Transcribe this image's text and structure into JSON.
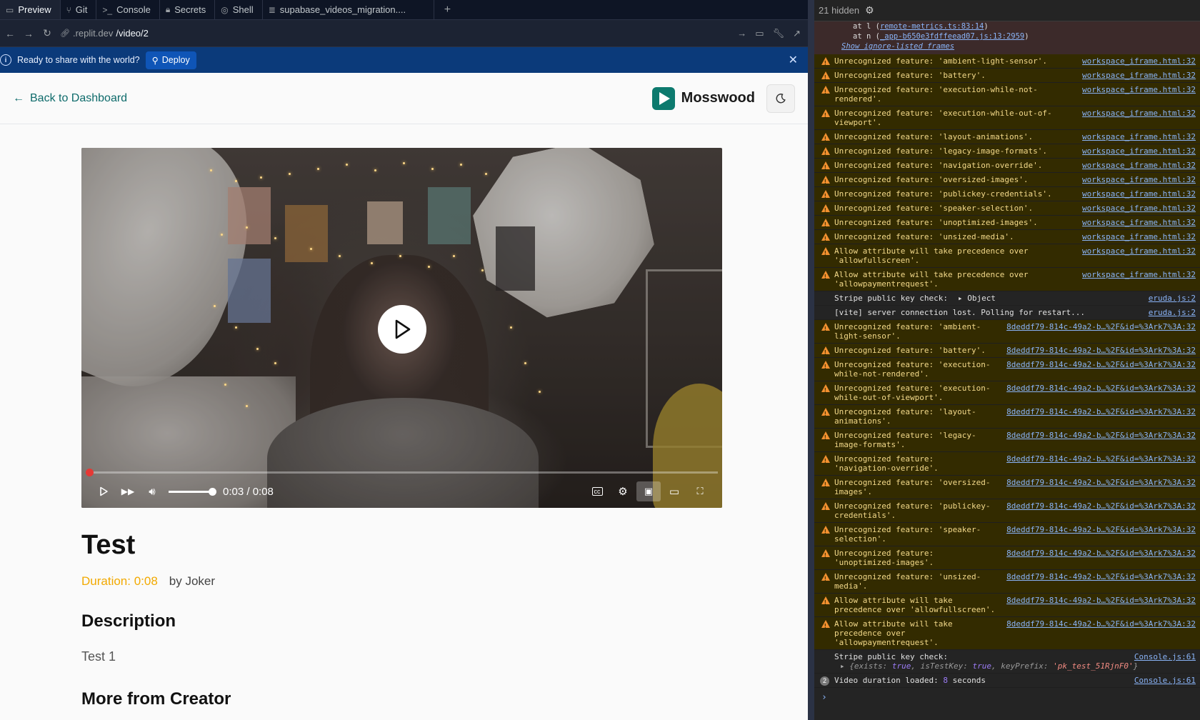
{
  "tabs": [
    {
      "label": "Preview",
      "icon": "monitor-icon",
      "active": true
    },
    {
      "label": "Git",
      "icon": "git-icon"
    },
    {
      "label": "Console",
      "icon": "terminal-icon"
    },
    {
      "label": "Secrets",
      "icon": "lock-icon"
    },
    {
      "label": "Shell",
      "icon": "shell-icon"
    },
    {
      "label": "supabase_videos_migration....",
      "icon": "database-icon"
    }
  ],
  "url": {
    "host": ".replit.dev",
    "path": "/video/2"
  },
  "deploy_bar": {
    "message": "Ready to share with the world?",
    "button": "Deploy"
  },
  "app": {
    "back_label": "Back to Dashboard",
    "brand": "Mosswood",
    "video": {
      "current_time": "0:03",
      "duration": "0:08",
      "time_display": "0:03 / 0:08",
      "progress_fraction": 0.006,
      "volume_fraction": 1.0
    },
    "title": "Test",
    "duration_label": "Duration: 0:08",
    "author_label": "by Joker",
    "description_heading": "Description",
    "description": "Test 1",
    "more_heading": "More from Creator"
  },
  "console": {
    "hidden_count": "21 hidden",
    "stack": {
      "line1_prefix": "at l (",
      "line1_link": "remote-metrics.ts:83:14",
      "line1_suffix": ")",
      "line2_prefix": "at n (",
      "line2_link": "_app-b650e3fdffeead07.js:13:2959",
      "line2_suffix": ")",
      "ignore_link": "Show ignore-listed frames"
    },
    "entries": [
      {
        "type": "warn",
        "text": "Unrecognized feature: 'ambient-light-sensor'.",
        "src": "workspace_iframe.html:32"
      },
      {
        "type": "warn",
        "text": "Unrecognized feature: 'battery'.",
        "src": "workspace_iframe.html:32"
      },
      {
        "type": "warn",
        "text": "Unrecognized feature: 'execution-while-not-\nrendered'.",
        "src": "workspace_iframe.html:32"
      },
      {
        "type": "warn",
        "text": "Unrecognized feature: 'execution-while-out-of-\nviewport'.",
        "src": "workspace_iframe.html:32"
      },
      {
        "type": "warn",
        "text": "Unrecognized feature: 'layout-animations'.",
        "src": "workspace_iframe.html:32"
      },
      {
        "type": "warn",
        "text": "Unrecognized feature: 'legacy-image-formats'.",
        "src": "workspace_iframe.html:32"
      },
      {
        "type": "warn",
        "text": "Unrecognized feature: 'navigation-override'.",
        "src": "workspace_iframe.html:32"
      },
      {
        "type": "warn",
        "text": "Unrecognized feature: 'oversized-images'.",
        "src": "workspace_iframe.html:32"
      },
      {
        "type": "warn",
        "text": "Unrecognized feature: 'publickey-credentials'.",
        "src": "workspace_iframe.html:32"
      },
      {
        "type": "warn",
        "text": "Unrecognized feature: 'speaker-selection'.",
        "src": "workspace_iframe.html:32"
      },
      {
        "type": "warn",
        "text": "Unrecognized feature: 'unoptimized-images'.",
        "src": "workspace_iframe.html:32"
      },
      {
        "type": "warn",
        "text": "Unrecognized feature: 'unsized-media'.",
        "src": "workspace_iframe.html:32"
      },
      {
        "type": "warn",
        "text": "Allow attribute will take precedence over\n'allowfullscreen'.",
        "src": "workspace_iframe.html:32"
      },
      {
        "type": "warn",
        "text": "Allow attribute will take precedence over\n'allowpaymentrequest'.",
        "src": "workspace_iframe.html:32"
      },
      {
        "type": "log",
        "text": "Stripe public key check:",
        "obj": "▸ Object",
        "src": "eruda.js:2"
      },
      {
        "type": "log",
        "text": "[vite] server connection lost. Polling for restart...",
        "src": "eruda.js:2"
      },
      {
        "type": "warn",
        "text": "Unrecognized feature: 'ambient-\nlight-sensor'.",
        "src": "8deddf79-814c-49a2-b…%2F&id=%3Ark7%3A:32"
      },
      {
        "type": "warn",
        "text": "Unrecognized feature: 'battery'.",
        "src": "8deddf79-814c-49a2-b…%2F&id=%3Ark7%3A:32"
      },
      {
        "type": "warn",
        "text": "Unrecognized feature: 'execution-\nwhile-not-rendered'.",
        "src": "8deddf79-814c-49a2-b…%2F&id=%3Ark7%3A:32"
      },
      {
        "type": "warn",
        "text": "Unrecognized feature: 'execution-\nwhile-out-of-viewport'.",
        "src": "8deddf79-814c-49a2-b…%2F&id=%3Ark7%3A:32"
      },
      {
        "type": "warn",
        "text": "Unrecognized feature: 'layout-\nanimations'.",
        "src": "8deddf79-814c-49a2-b…%2F&id=%3Ark7%3A:32"
      },
      {
        "type": "warn",
        "text": "Unrecognized feature: 'legacy-\nimage-formats'.",
        "src": "8deddf79-814c-49a2-b…%2F&id=%3Ark7%3A:32"
      },
      {
        "type": "warn",
        "text": "Unrecognized feature:\n'navigation-override'.",
        "src": "8deddf79-814c-49a2-b…%2F&id=%3Ark7%3A:32"
      },
      {
        "type": "warn",
        "text": "Unrecognized feature: 'oversized-\nimages'.",
        "src": "8deddf79-814c-49a2-b…%2F&id=%3Ark7%3A:32"
      },
      {
        "type": "warn",
        "text": "Unrecognized feature: 'publickey-\ncredentials'.",
        "src": "8deddf79-814c-49a2-b…%2F&id=%3Ark7%3A:32"
      },
      {
        "type": "warn",
        "text": "Unrecognized feature: 'speaker-\nselection'.",
        "src": "8deddf79-814c-49a2-b…%2F&id=%3Ark7%3A:32"
      },
      {
        "type": "warn",
        "text": "Unrecognized feature:\n'unoptimized-images'.",
        "src": "8deddf79-814c-49a2-b…%2F&id=%3Ark7%3A:32"
      },
      {
        "type": "warn",
        "text": "Unrecognized feature: 'unsized-\nmedia'.",
        "src": "8deddf79-814c-49a2-b…%2F&id=%3Ark7%3A:32"
      },
      {
        "type": "warn",
        "text": "Allow attribute will take\nprecedence over 'allowfullscreen'.",
        "src": "8deddf79-814c-49a2-b…%2F&id=%3Ark7%3A:32"
      },
      {
        "type": "warn",
        "text": "Allow attribute will take\nprecedence over 'allowpaymentrequest'.",
        "src": "8deddf79-814c-49a2-b…%2F&id=%3Ark7%3A:32"
      }
    ],
    "stripe_log": {
      "text": "Stripe public key check:",
      "src": "Console.js:61",
      "obj": {
        "k1": "exists",
        "v1": "true",
        "k2": "isTestKey",
        "v2": "true",
        "k3": "keyPrefix",
        "v3": "'pk_test_51RjnF0'"
      }
    },
    "duration_log": {
      "count": "2",
      "text_before": "Video duration loaded:",
      "value": "8",
      "text_after": "seconds",
      "src": "Console.js:61"
    },
    "prompt": "›"
  },
  "colors": {
    "accent": "#0d7a6e",
    "deploy_bar": "#0b3a7a",
    "warn_bg": "#332b00",
    "duration": "#f2a900",
    "progress": "#e53935"
  }
}
